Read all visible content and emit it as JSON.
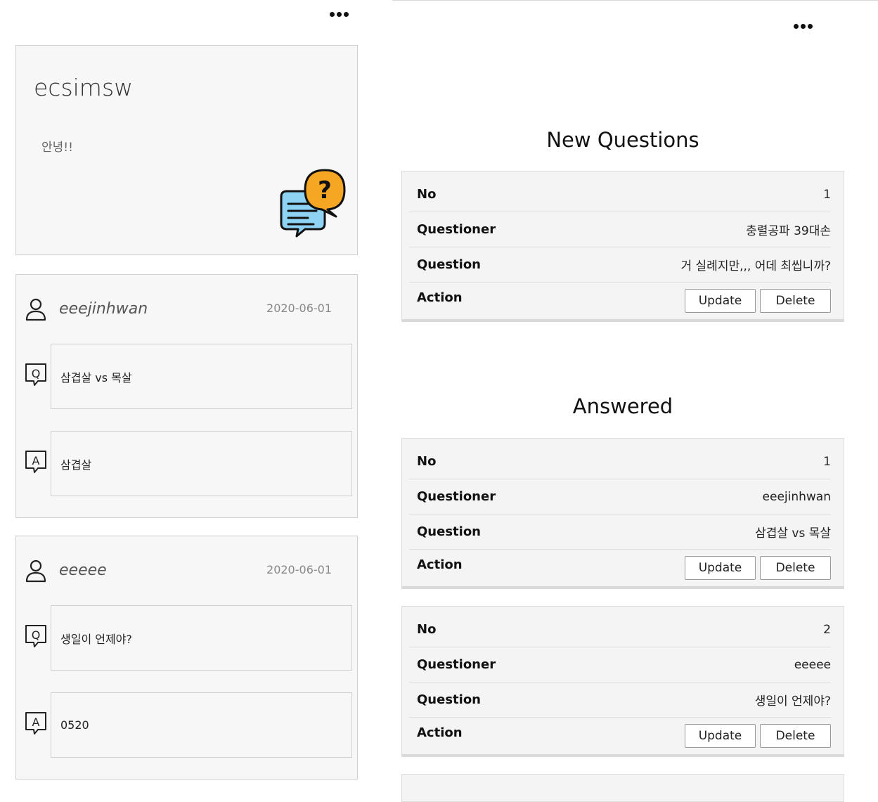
{
  "profile": {
    "username": "ecsimsw",
    "bio": "안녕!!"
  },
  "left_feed": [
    {
      "user": "eeejinhwan",
      "date": "2020-06-01",
      "question": "삼겹살 vs 목살",
      "answer": "삼겹살"
    },
    {
      "user": "eeeee",
      "date": "2020-06-01",
      "question": "생일이 언제야?",
      "answer": "0520"
    }
  ],
  "new_questions": {
    "title": "New Questions",
    "items": [
      {
        "no_label": "No",
        "no": "1",
        "questioner_label": "Questioner",
        "questioner": "충렬공파 39대손",
        "question_label": "Question",
        "question": "거 실례지만,,, 어데 최씹니까?",
        "action_label": "Action",
        "update_label": "Update",
        "delete_label": "Delete"
      }
    ]
  },
  "answered": {
    "title": "Answered",
    "items": [
      {
        "no_label": "No",
        "no": "1",
        "questioner_label": "Questioner",
        "questioner": "eeejinhwan",
        "question_label": "Question",
        "question": "삼겹살 vs 목살",
        "action_label": "Action",
        "update_label": "Update",
        "delete_label": "Delete"
      },
      {
        "no_label": "No",
        "no": "2",
        "questioner_label": "Questioner",
        "questioner": "eeeee",
        "question_label": "Question",
        "question": "생일이 언제야?",
        "action_label": "Action",
        "update_label": "Update",
        "delete_label": "Delete"
      }
    ]
  },
  "icons": {
    "more": "more-horizontal-icon",
    "user": "user-icon",
    "question_badge": "question-badge-icon",
    "answer_badge": "answer-badge-icon",
    "chat": "chat-question-icon"
  },
  "colors": {
    "chat_bubble_orange": "#F5A623",
    "chat_bubble_blue": "#8FD3F4"
  }
}
